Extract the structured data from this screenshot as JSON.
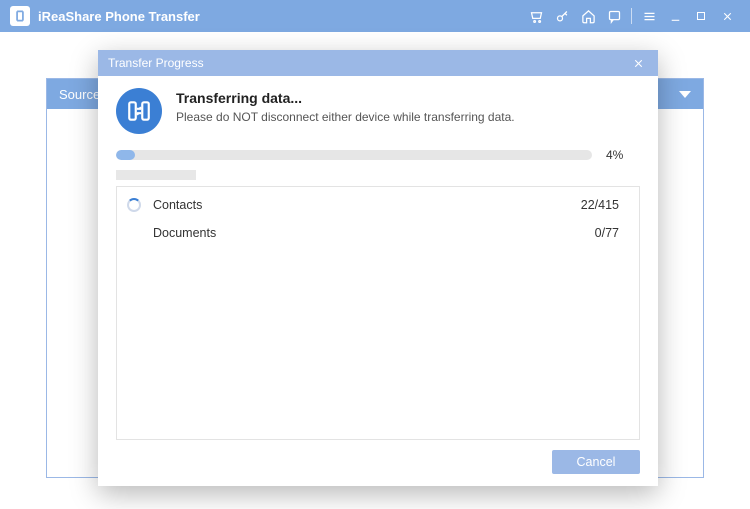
{
  "app_title": "iReaShare Phone Transfer",
  "background": {
    "source_label": "Source:"
  },
  "dialog": {
    "title": "Transfer Progress",
    "heading": "Transferring data...",
    "warning": "Please do NOT disconnect either device while transferring data.",
    "percent_text": "4%",
    "percent_value": 4,
    "items": [
      {
        "name": "Contacts",
        "count": "22/415",
        "spinning": true
      },
      {
        "name": "Documents",
        "count": "0/77",
        "spinning": false
      }
    ],
    "cancel": "Cancel"
  }
}
